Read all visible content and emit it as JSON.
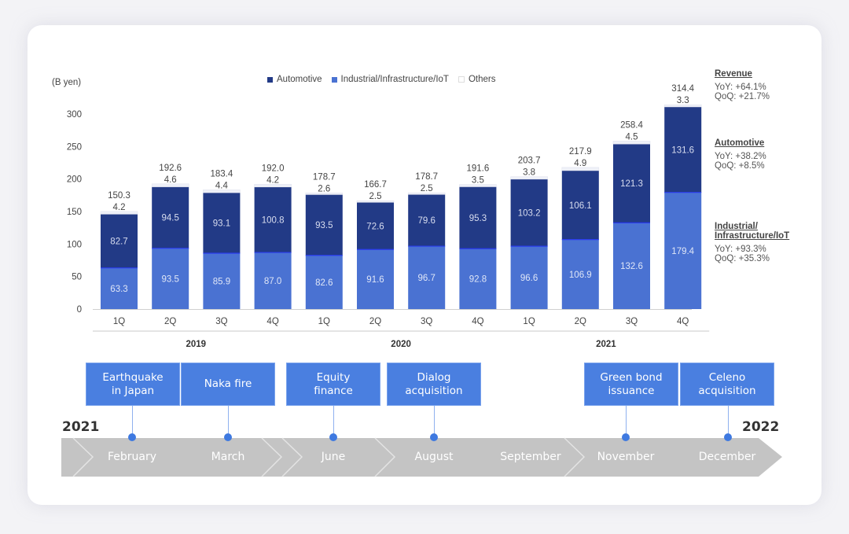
{
  "chart_data": {
    "type": "bar",
    "stacked": true,
    "unit_label": "(B yen)",
    "ylim": [
      0,
      300
    ],
    "yticks": [
      0,
      50,
      100,
      150,
      200,
      250,
      300
    ],
    "categories": [
      "1Q",
      "2Q",
      "3Q",
      "4Q",
      "1Q",
      "2Q",
      "3Q",
      "4Q",
      "1Q",
      "2Q",
      "3Q",
      "4Q"
    ],
    "years": [
      {
        "label": "2019",
        "span": [
          0,
          3
        ]
      },
      {
        "label": "2020",
        "span": [
          4,
          7
        ]
      },
      {
        "label": "2021",
        "span": [
          8,
          11
        ]
      }
    ],
    "series": [
      {
        "name": "Industrial/Infrastructure/IoT",
        "color": "#4a72d2",
        "values": [
          63.3,
          93.5,
          85.9,
          87.0,
          82.6,
          91.6,
          96.7,
          92.8,
          96.6,
          106.9,
          132.6,
          179.4
        ]
      },
      {
        "name": "Automotive",
        "color": "#223a86",
        "values": [
          82.7,
          94.5,
          93.1,
          100.8,
          93.5,
          72.6,
          79.6,
          95.3,
          103.2,
          106.1,
          121.3,
          131.6
        ]
      },
      {
        "name": "Others",
        "color": "#eef0f8",
        "values": [
          4.2,
          4.6,
          4.4,
          4.2,
          2.6,
          2.5,
          2.5,
          3.5,
          3.8,
          4.9,
          4.5,
          3.3
        ]
      }
    ],
    "totals": [
      150.3,
      192.6,
      183.4,
      192.0,
      178.7,
      166.7,
      178.7,
      191.6,
      203.7,
      217.9,
      258.4,
      314.4
    ],
    "legend": [
      "Automotive",
      "Industrial/Infrastructure/IoT",
      "Others"
    ],
    "legend_position": "top-center",
    "grid": false
  },
  "legend": {
    "items": [
      {
        "label": "Automotive",
        "color": "#223a86"
      },
      {
        "label": "Industrial/Infrastructure/IoT",
        "color": "#4a72d2"
      },
      {
        "label": "Others",
        "color": "#eef0f8"
      }
    ]
  },
  "side_notes": [
    {
      "heading": "Revenue",
      "lines": [
        "YoY: +64.1%",
        "QoQ: +21.7%"
      ]
    },
    {
      "heading": "Automotive",
      "lines": [
        "YoY: +38.2%",
        "QoQ: +8.5%"
      ]
    },
    {
      "heading": "Industrial/",
      "heading2": "Infrastructure/IoT",
      "lines": [
        "YoY: +93.3%",
        "QoQ: +35.3%"
      ]
    }
  ],
  "timeline": {
    "start_year": "2021",
    "end_year": "2022",
    "months": [
      "February",
      "March",
      "June",
      "August",
      "September",
      "November",
      "December"
    ],
    "events": [
      {
        "line1": "Earthquake",
        "line2": "in Japan",
        "month": "February"
      },
      {
        "line1": "Naka fire",
        "line2": "",
        "month": "March"
      },
      {
        "line1": "Equity",
        "line2": "finance",
        "month": "June"
      },
      {
        "line1": "Dialog",
        "line2": "acquisition",
        "month": "August"
      },
      {
        "line1": "Green bond",
        "line2": "issuance",
        "month": "November"
      },
      {
        "line1": "Celeno",
        "line2": "acquisition",
        "month": "December"
      }
    ],
    "colors": {
      "event_box": "#4a7fe0",
      "arrow": "#c4c4c4",
      "dot": "#3e79e0"
    }
  }
}
